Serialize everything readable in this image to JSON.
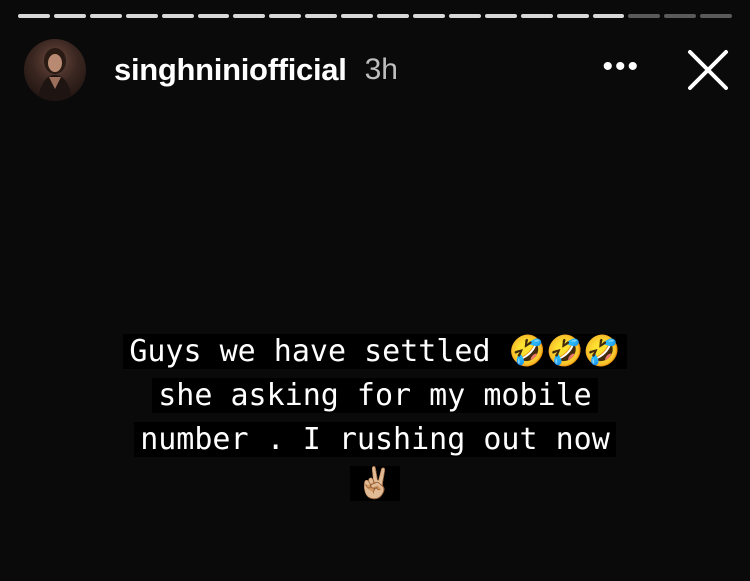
{
  "story": {
    "progress": {
      "total_segments": 20,
      "viewed_segments": 17
    },
    "author": {
      "username": "singhniniofficial",
      "posted_ago": "3h"
    },
    "actions": {
      "more_icon": "more-horizontal-icon",
      "more_glyph": "•••",
      "close_icon": "close-icon"
    },
    "caption": {
      "line1_text": "Guys we have settled",
      "line1_emoji": "🤣🤣🤣",
      "line2_text": "she asking for my mobile",
      "line3_text": "number . I rushing out now",
      "line4_emoji": "✌🏼"
    },
    "colors": {
      "background": "#0a0a0a",
      "progress_viewed": "#d8d8d8",
      "progress_upcoming": "#5a5a5a",
      "text": "#ffffff",
      "timestamp": "#bdbdbd"
    }
  }
}
